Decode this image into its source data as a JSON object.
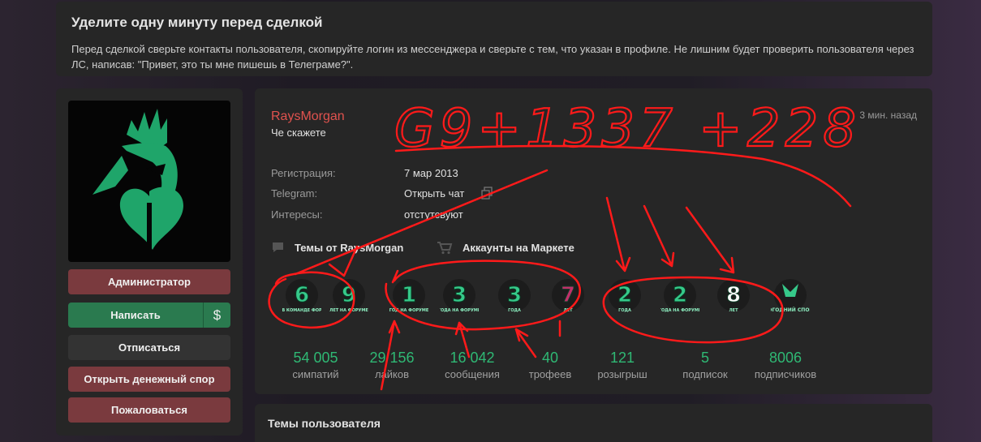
{
  "notice": {
    "title": "Уделите одну минуту перед сделкой",
    "text": "Перед сделкой сверьте контакты пользователя, скопируйте логин из мессенджера и сверьте с тем, что указан в профиле. Не лишним будет проверить пользователя через ЛС, написав: \"Привет, это ты мне пишешь в Телеграме?\"."
  },
  "sidebar": {
    "role_label": "Администратор",
    "write_label": "Написать",
    "dollar_glyph": "$",
    "unsubscribe_label": "Отписаться",
    "dispute_label": "Открыть денежный спор",
    "complain_label": "Пожаловаться"
  },
  "profile": {
    "username": "RaysMorgan",
    "status": "Че скажете",
    "time": "3 мин. назад",
    "info": [
      {
        "key": "Регистрация:",
        "value": "7 мар 2013"
      },
      {
        "key": "Telegram:",
        "value": "Открыть чат"
      },
      {
        "key": "Интересы:",
        "value": "отстутсвуют"
      }
    ],
    "links": {
      "topics": "Темы от RaysMorgan",
      "market": "Аккаунты на Маркете"
    },
    "badges": [
      {
        "name": "6 лет в команде форума",
        "main": "6",
        "sub": "ЛЕТ В КОМАНДЕ ФОРУМА",
        "color": "#36c98a"
      },
      {
        "name": "9 лет на форуме",
        "main": "9",
        "sub": "ЛЕТ НА ФОРУМЕ",
        "color": "#36c98a"
      },
      {
        "name": "1 год на форуме",
        "main": "1",
        "sub": "ГОД НА ФОРУМЕ",
        "color": "#36c98a"
      },
      {
        "name": "3 года на форуме",
        "main": "3",
        "sub": "ГОДА НА ФОРУМЕ",
        "color": "#36c98a"
      },
      {
        "name": "3 года",
        "main": "3",
        "sub": "ГОДА",
        "color": "#36c98a"
      },
      {
        "name": "7 лет",
        "main": "7",
        "sub": "ЛЕТ",
        "color": "#c0306a"
      },
      {
        "name": "2 года",
        "main": "2",
        "sub": "ГОДА",
        "color": "#36c98a"
      },
      {
        "name": "2 года на форуме",
        "main": "2",
        "sub": "ГОДА НА ФОРУМЕ",
        "color": "#36c98a"
      },
      {
        "name": "8 лет",
        "main": "8",
        "sub": "ЛЕТ",
        "color": "#ffffff"
      },
      {
        "name": "Новогодний спонсор",
        "main": "",
        "sub": "НОВОГОДНИЙ СПОНСОР",
        "color": "#36c98a"
      }
    ],
    "stats": [
      {
        "value": "54 005",
        "label": "симпатий"
      },
      {
        "value": "29 156",
        "label": "лайков"
      },
      {
        "value": "16 042",
        "label": "сообщения"
      },
      {
        "value": "40",
        "label": "трофеев"
      },
      {
        "value": "121",
        "label": "розыгрыш"
      },
      {
        "value": "5",
        "label": "подписок"
      },
      {
        "value": "8006",
        "label": "подписчиков"
      }
    ]
  },
  "topics_section": {
    "title": "Темы пользователя"
  },
  "annotation": {
    "handwriting": "G9+1337 +228"
  },
  "colors": {
    "accent_green": "#2fb874",
    "username_red": "#e0524e",
    "scribble_red": "#ff1a1a"
  }
}
